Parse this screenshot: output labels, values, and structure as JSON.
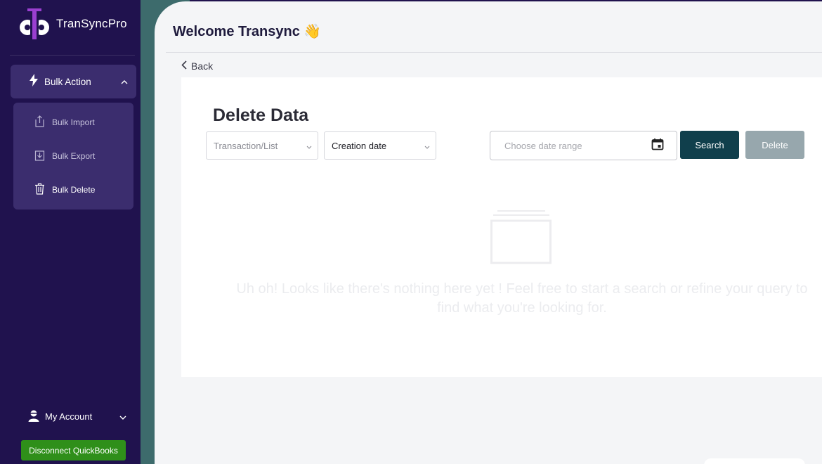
{
  "brand": {
    "name": "TranSyncPro"
  },
  "sidebar": {
    "group": {
      "label": "Bulk Action",
      "icon": "lightning-icon"
    },
    "items": [
      {
        "label": "Bulk Import",
        "icon": "upload-icon"
      },
      {
        "label": "Bulk Export",
        "icon": "download-icon"
      },
      {
        "label": "Bulk Delete",
        "icon": "trash-icon"
      }
    ],
    "account_label": "My Account",
    "disconnect_label": "Disconnect QuickBooks"
  },
  "header": {
    "welcome": "Welcome Transync 👋"
  },
  "nav": {
    "back_label": "Back"
  },
  "page": {
    "title": "Delete Data",
    "filters": {
      "type_value": "Transaction/List",
      "date_field_value": "Creation date",
      "date_range_placeholder": "Choose date range"
    },
    "buttons": {
      "search": "Search",
      "delete": "Delete"
    },
    "empty_message": "Uh oh! Looks like there's nothing here yet ! Feel free to start a search or refine your query to find what you're looking for."
  },
  "colors": {
    "sidebar_bg": "#20124e",
    "sidebar_active": "#3b2d6e",
    "teal_accent": "#3d6b6c",
    "search_button": "#103f4c",
    "delete_button_disabled": "#97a7ad",
    "disconnect_button": "#2f8f1a",
    "logo_accent": "#9b3fd1"
  }
}
